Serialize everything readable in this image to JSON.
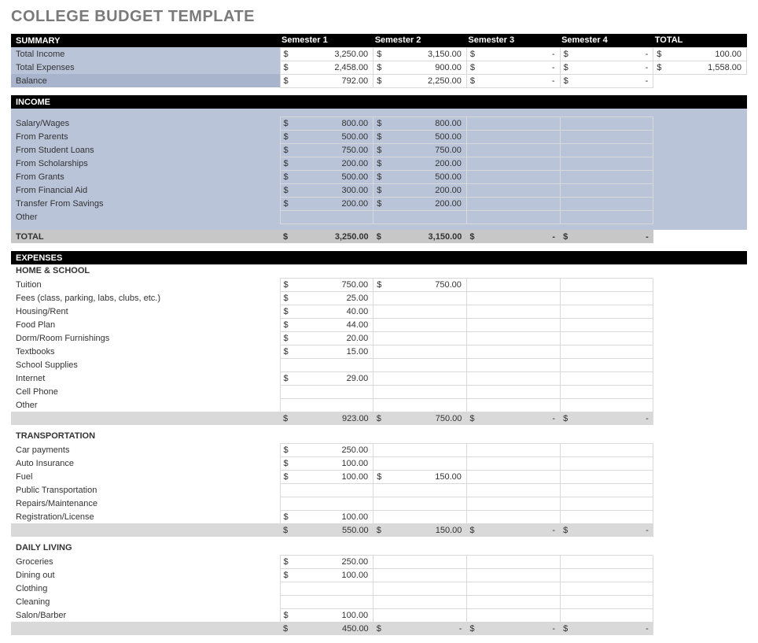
{
  "title": "COLLEGE BUDGET TEMPLATE",
  "columns": {
    "label": "SUMMARY",
    "s1": "Semester 1",
    "s2": "Semester 2",
    "s3": "Semester 3",
    "s4": "Semester 4",
    "total": "TOTAL"
  },
  "summary": {
    "rows": [
      {
        "label": "Total Income",
        "s1": "3,250.00",
        "s2": "3,150.00",
        "s3": "-",
        "s4": "-",
        "total": "100.00"
      },
      {
        "label": "Total Expenses",
        "s1": "2,458.00",
        "s2": "900.00",
        "s3": "-",
        "s4": "-",
        "total": "1,558.00"
      },
      {
        "label": "Balance",
        "s1": "792.00",
        "s2": "2,250.00",
        "s3": "-",
        "s4": "-",
        "total": ""
      }
    ]
  },
  "income": {
    "header": "INCOME",
    "rows": [
      {
        "label": "Salary/Wages",
        "s1": "800.00",
        "s2": "800.00"
      },
      {
        "label": "From Parents",
        "s1": "500.00",
        "s2": "500.00"
      },
      {
        "label": "From Student Loans",
        "s1": "750.00",
        "s2": "750.00"
      },
      {
        "label": "From Scholarships",
        "s1": "200.00",
        "s2": "200.00"
      },
      {
        "label": "From Grants",
        "s1": "500.00",
        "s2": "500.00"
      },
      {
        "label": "From Financial Aid",
        "s1": "300.00",
        "s2": "200.00"
      },
      {
        "label": "Transfer From Savings",
        "s1": "200.00",
        "s2": "200.00"
      },
      {
        "label": "Other",
        "s1": "",
        "s2": ""
      }
    ],
    "total": {
      "label": "TOTAL",
      "s1": "3,250.00",
      "s2": "3,150.00",
      "s3": "-",
      "s4": "-"
    }
  },
  "expenses": {
    "header": "EXPENSES",
    "groups": [
      {
        "name": "HOME & SCHOOL",
        "rows": [
          {
            "label": "Tuition",
            "s1": "750.00",
            "s2": "750.00"
          },
          {
            "label": "Fees (class, parking, labs, clubs, etc.)",
            "s1": "25.00"
          },
          {
            "label": "Housing/Rent",
            "s1": "40.00"
          },
          {
            "label": "Food Plan",
            "s1": "44.00"
          },
          {
            "label": "Dorm/Room Furnishings",
            "s1": "20.00"
          },
          {
            "label": "Textbooks",
            "s1": "15.00"
          },
          {
            "label": "School Supplies"
          },
          {
            "label": "Internet",
            "s1": "29.00"
          },
          {
            "label": "Cell Phone"
          },
          {
            "label": "Other"
          }
        ],
        "subtotal": {
          "s1": "923.00",
          "s2": "750.00",
          "s3": "-",
          "s4": "-"
        }
      },
      {
        "name": "TRANSPORTATION",
        "rows": [
          {
            "label": "Car payments",
            "s1": "250.00"
          },
          {
            "label": "Auto Insurance",
            "s1": "100.00"
          },
          {
            "label": "Fuel",
            "s1": "100.00",
            "s2": "150.00"
          },
          {
            "label": "Public Transportation"
          },
          {
            "label": "Repairs/Maintenance"
          },
          {
            "label": "Registration/License",
            "s1": "100.00"
          }
        ],
        "subtotal": {
          "s1": "550.00",
          "s2": "150.00",
          "s3": "-",
          "s4": "-"
        }
      },
      {
        "name": "DAILY LIVING",
        "rows": [
          {
            "label": "Groceries",
            "s1": "250.00"
          },
          {
            "label": "Dining out",
            "s1": "100.00"
          },
          {
            "label": "Clothing"
          },
          {
            "label": "Cleaning"
          },
          {
            "label": "Salon/Barber",
            "s1": "100.00"
          }
        ],
        "subtotal": {
          "s1": "450.00",
          "s2": "-",
          "s3": "-",
          "s4": "-"
        }
      }
    ]
  },
  "currency": "$"
}
